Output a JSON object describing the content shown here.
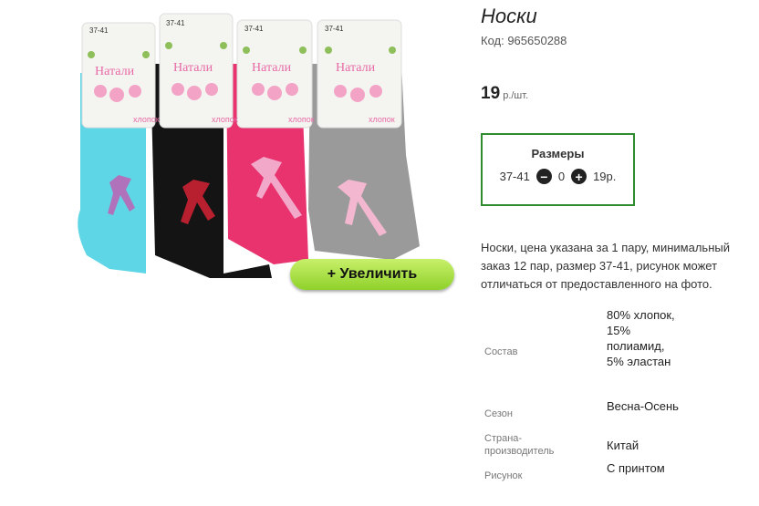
{
  "product": {
    "title": "Носки",
    "code": "Код: 965650288",
    "price": "19",
    "price_unit": " р./шт.",
    "zoom_button": "+  Увеличить",
    "image_labels": {
      "brand": "Натали",
      "size": "37-41",
      "material": "хлопок"
    }
  },
  "sizes": {
    "title": "Размеры",
    "size": "37-41",
    "quantity": "0",
    "price": "19р."
  },
  "description": "Носки, цена указана за 1 пару, минимальный заказ 12 пар, размер 37-41, рисунок может отличаться от предоставленного на фото.",
  "specs": [
    {
      "label": "Состав",
      "value": "80% хлопок, 15% полиамид, 5% эластан"
    },
    {
      "label": "Сезон",
      "value": "Весна-Осень"
    },
    {
      "label": "Страна-производитель",
      "value": "Китай"
    },
    {
      "label": "Рисунок",
      "value": "С принтом"
    }
  ],
  "colors": {
    "accent_green": "#2e8b2e",
    "button_green": "#a6de3c",
    "sock_cyan": "#5fd6e6",
    "sock_black": "#111111",
    "sock_pink": "#e8336f",
    "sock_gray": "#9a9a9a"
  }
}
